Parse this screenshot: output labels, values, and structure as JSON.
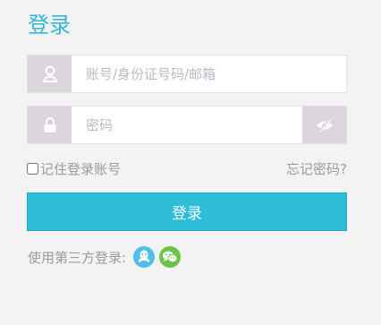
{
  "title": "登录",
  "username": {
    "placeholder": "账号/身份证号码/邮箱",
    "value": "",
    "icon": "user-icon"
  },
  "password": {
    "placeholder": "密码",
    "value": "",
    "icon": "lock-icon",
    "toggle_icon": "eye-slash-icon"
  },
  "remember_label": "记住登录账号",
  "forgot_label": "忘记密码?",
  "login_label": "登录",
  "third_party": {
    "label": "使用第三方登录:",
    "providers": [
      {
        "name": "qq-icon",
        "color": "#54bdf0"
      },
      {
        "name": "wechat-icon",
        "color": "#6cc24a"
      }
    ]
  },
  "colors": {
    "accent": "#2ebdd9",
    "title": "#38b6d3",
    "icon_bg": "#dbd4dc"
  }
}
